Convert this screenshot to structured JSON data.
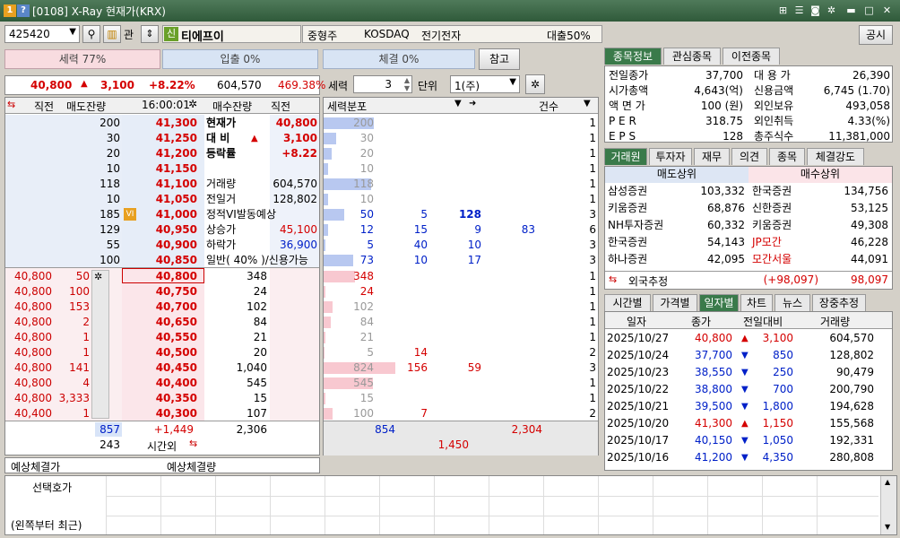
{
  "window": {
    "title": "[0108] X-Ray 현재가(KRX)",
    "icon1": "1",
    "icon2": "?"
  },
  "top": {
    "code": "425420",
    "gwan": "관",
    "sin": "신",
    "name": "티에프이",
    "market_type": "중형주",
    "market": "KOSDAQ",
    "sector": "전기전자",
    "loan": "대출50%",
    "share": "공시"
  },
  "ratio": {
    "seryuk": "세력 77%",
    "ipchul": "입출 0%",
    "chegyul": "체결 0%",
    "ref": "참고"
  },
  "price": {
    "cur": "40,800",
    "arrow": "▲",
    "diff": "3,100",
    "pct": "+8.22%",
    "vol": "604,570",
    "turn": "469.38%"
  },
  "ctrl": {
    "seryuk_label": "세력",
    "seryuk_val": "3",
    "unit_label": "단위",
    "unit_val": "1(주)"
  },
  "hoga_head": {
    "c1": "직전",
    "c2": "매도잔량",
    "time": "16:00:01",
    "c4": "매수잔량",
    "c5": "직전",
    "dist": "세력분포",
    "cnt": "건수"
  },
  "ask": [
    {
      "q": "200",
      "p": "41,300",
      "d": "200",
      "n": "1"
    },
    {
      "q": "30",
      "p": "41,250",
      "d": "30",
      "n": "1"
    },
    {
      "q": "20",
      "p": "41,200",
      "d": "20",
      "n": "1"
    },
    {
      "q": "10",
      "p": "41,150",
      "d": "10",
      "n": "1"
    },
    {
      "q": "118",
      "p": "41,100",
      "d": "118",
      "n": "1"
    },
    {
      "q": "10",
      "p": "41,050",
      "d": "10",
      "n": "1"
    },
    {
      "q": "185",
      "p": "41,000",
      "d": "50",
      "d2": "5",
      "d3": "128",
      "n": "3"
    },
    {
      "q": "129",
      "p": "40,950",
      "d": "12",
      "d2": "15",
      "d3": "9",
      "d4": "83",
      "n": "6"
    },
    {
      "q": "55",
      "p": "40,900",
      "d": "5",
      "d2": "40",
      "d3": "10",
      "n": "3"
    },
    {
      "q": "100",
      "p": "40,850",
      "d": "73",
      "d2": "10",
      "d3": "17",
      "n": "3"
    }
  ],
  "mid": {
    "r1": {
      "k": "현재가",
      "v": "40,800"
    },
    "r2": {
      "k": "대 비",
      "a": "▲",
      "v": "3,100"
    },
    "r3": {
      "k": "등락률",
      "v": "+8.22"
    },
    "r5": {
      "k": "거래량",
      "v": "604,570"
    },
    "r6": {
      "k": "전일거",
      "v": "128,802"
    },
    "r7": {
      "k": "정적VI발동예상"
    },
    "r8": {
      "k": "상승가",
      "v": "45,100"
    },
    "r9": {
      "k": "하락가",
      "v": "36,900"
    },
    "r10": {
      "k": "일반( 40% )/신용가능"
    },
    "vi": "VI"
  },
  "bid": [
    {
      "prev": "40,800",
      "pq": "50",
      "p": "40,800",
      "q": "348",
      "d": "348",
      "n": "1"
    },
    {
      "prev": "40,800",
      "pq": "100",
      "p": "40,750",
      "q": "24",
      "d": "24",
      "n": "1"
    },
    {
      "prev": "40,800",
      "pq": "153",
      "p": "40,700",
      "q": "102",
      "d": "102",
      "n": "1"
    },
    {
      "prev": "40,800",
      "pq": "2",
      "p": "40,650",
      "q": "84",
      "d": "84",
      "n": "1"
    },
    {
      "prev": "40,800",
      "pq": "1",
      "p": "40,550",
      "q": "21",
      "d": "21",
      "n": "1"
    },
    {
      "prev": "40,800",
      "pq": "1",
      "p": "40,500",
      "q": "20",
      "d": "5",
      "d2": "14",
      "n": "2"
    },
    {
      "prev": "40,800",
      "pq": "141",
      "p": "40,450",
      "q": "1,040",
      "d": "824",
      "d2": "156",
      "d3": "59",
      "n": "3"
    },
    {
      "prev": "40,800",
      "pq": "4",
      "p": "40,400",
      "q": "545",
      "d": "545",
      "n": "1"
    },
    {
      "prev": "40,800",
      "pq": "3,333",
      "p": "40,350",
      "q": "15",
      "d": "15",
      "n": "1"
    },
    {
      "prev": "40,400",
      "pq": "1",
      "p": "40,300",
      "q": "107",
      "d": "100",
      "d2": "7",
      "n": "2"
    }
  ],
  "totals": {
    "ask_total": "857",
    "diff": "+1,449",
    "bid_total": "2,306",
    "after": "243",
    "after_label": "시간외",
    "dist_ask": "854",
    "dist_bid": "2,304",
    "dist_sum": "1,450"
  },
  "expect": {
    "price": "예상체결가",
    "vol": "예상체결량"
  },
  "select": {
    "l1": "선택호가",
    "l2": "(왼쪽부터 최근)"
  },
  "info_tabs": [
    "종목정보",
    "관심종목",
    "이전종목"
  ],
  "info": [
    {
      "k1": "전일종가",
      "v1": "37,700",
      "k2": "대 용 가",
      "v2": "26,390"
    },
    {
      "k1": "시가총액",
      "v1": "4,643(억)",
      "k2": "신용금액",
      "v2": "6,745  (1.70)"
    },
    {
      "k1": "액 면 가",
      "v1": "100 (원)",
      "k2": "외인보유",
      "v2": "493,058"
    },
    {
      "k1": "P E R",
      "v1": "318.75",
      "k2": "외인취득",
      "v2": "4.33(%)"
    },
    {
      "k1": "E P S",
      "v1": "128",
      "k2": "총주식수",
      "v2": "11,381,000"
    }
  ],
  "broker_tabs": [
    "거래원",
    "투자자",
    "재무",
    "의견",
    "종목",
    "체결강도"
  ],
  "broker_head": {
    "sell": "매도상위",
    "buy": "매수상위"
  },
  "brokers": [
    {
      "s": "삼성증권",
      "sv": "103,332",
      "b": "한국증권",
      "bv": "134,756"
    },
    {
      "s": "키움증권",
      "sv": "68,876",
      "b": "신한증권",
      "bv": "53,125"
    },
    {
      "s": "NH투자증권",
      "sv": "60,332",
      "b": "키움증권",
      "bv": "49,308"
    },
    {
      "s": "한국증권",
      "sv": "54,143",
      "b": "JP모간",
      "bv": "46,228"
    },
    {
      "s": "하나증권",
      "sv": "42,095",
      "b": "모간서울",
      "bv": "44,091"
    }
  ],
  "foreign": {
    "label": "외국추정",
    "sv": "(+98,097)",
    "bv": "98,097"
  },
  "daily_tabs": [
    "시간별",
    "가격별",
    "일자별",
    "차트",
    "뉴스",
    "장중추정"
  ],
  "daily_head": {
    "date": "일자",
    "close": "종가",
    "diff": "전일대비",
    "vol": "거래량"
  },
  "daily": [
    {
      "date": "2025/10/27",
      "close": "40,800",
      "a": "▲",
      "diff": "3,100",
      "vol": "604,570",
      "up": true
    },
    {
      "date": "2025/10/24",
      "close": "37,700",
      "a": "▼",
      "diff": "850",
      "vol": "128,802",
      "up": false
    },
    {
      "date": "2025/10/23",
      "close": "38,550",
      "a": "▼",
      "diff": "250",
      "vol": "90,479",
      "up": false
    },
    {
      "date": "2025/10/22",
      "close": "38,800",
      "a": "▼",
      "diff": "700",
      "vol": "200,790",
      "up": false
    },
    {
      "date": "2025/10/21",
      "close": "39,500",
      "a": "▼",
      "diff": "1,800",
      "vol": "194,628",
      "up": false
    },
    {
      "date": "2025/10/20",
      "close": "41,300",
      "a": "▲",
      "diff": "1,150",
      "vol": "155,568",
      "up": true
    },
    {
      "date": "2025/10/17",
      "close": "40,150",
      "a": "▼",
      "diff": "1,050",
      "vol": "192,331",
      "up": false
    },
    {
      "date": "2025/10/16",
      "close": "41,200",
      "a": "▼",
      "diff": "4,350",
      "vol": "280,808",
      "up": false
    }
  ]
}
